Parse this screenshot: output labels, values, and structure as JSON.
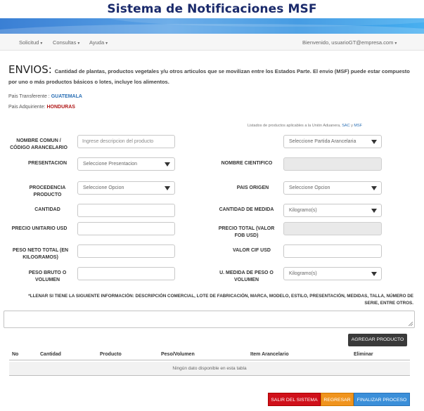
{
  "app_title": "Sistema de Notificaciones MSF",
  "nav": {
    "items": [
      "Solicitud",
      "Consultas",
      "Ayuda"
    ],
    "user": "Bienvenido, usuarioGT@empresa.com"
  },
  "intro": {
    "heading": "ENVIOS:",
    "description": "Cantidad de plantas, productos vegetales y/u otros articulos que se movilizan entre los Estados Parte. El envio (MSF) puede estar compuesto por uno o más productos básicos o lotes, incluye los alimentos."
  },
  "countries": {
    "transferente_label": "Pais Transferente :",
    "transferente_value": "GUATEMALA",
    "adquiriente_label": "Pais Adquiriente:",
    "adquiriente_value": "HONDURAS"
  },
  "listado": {
    "text": "Listados de productos aplicables a la Unión Aduanera,",
    "link_sac": "SAC",
    "joiner": "y",
    "link_msf": "MSF"
  },
  "form": {
    "nombre_comun_label": "NOMBRE COMUN / CÓDIGO ARANCELARIO",
    "nombre_comun_placeholder": "Ingrese descripcion del producto",
    "partida_placeholder": "Seleccione Partida Arancelaria",
    "presentacion_label": "PRESENTACION",
    "presentacion_value": "Seleccione Presentacion",
    "nombre_cientifico_label": "NOMBRE CIENTIFICO",
    "procedencia_label": "PROCEDENCIA PRODUCTO",
    "procedencia_value": "Seleccione Opcion",
    "pais_origen_label": "PAIS ORIGEN",
    "pais_origen_value": "Seleccione Opcion",
    "cantidad_label": "CANTIDAD",
    "cantidad_medida_label": "CANTIDAD DE MEDIDA",
    "cantidad_medida_value": "Kilogramo(s)",
    "precio_unitario_label": "PRECIO UNITARIO USD",
    "precio_total_label": "PRECIO TOTAL (VALOR FOB USD)",
    "peso_neto_label": "PESO NETO TOTAL (EN KILOGRAMOS)",
    "valor_cif_label": "VALOR CIF USD",
    "peso_bruto_label": "PESO BRUTO O VOLUMEN",
    "u_medida_label": "U. MEDIDA DE PESO O VOLUMEN",
    "u_medida_value": "Kilogramo(s)"
  },
  "note": "*LLENAR SI TIENE LA SIGUIENTE INFORMACIÓN: DESCRIPCIÓN COMERCIAL, LOTE DE FABRICACIÓN, MARCA, MODELO, ESTILO, PRESENTACIÓN, MEDIDAS, TALLA, NÚMERO DE SERIE, ENTRE OTROS.",
  "agregar_button": "AGREGAR PRODUCTO",
  "table": {
    "columns": [
      "No",
      "Cantidad",
      "Producto",
      "Peso/Volumen",
      "Item Arancelario",
      "Eliminar"
    ],
    "empty_text": "Ningún dato disponible en esta tabla"
  },
  "actions": {
    "salir": "SALIR DEL SISTEMA",
    "regresar": "REGRESAR",
    "finalizar": "FINALIZAR PROCESO"
  }
}
